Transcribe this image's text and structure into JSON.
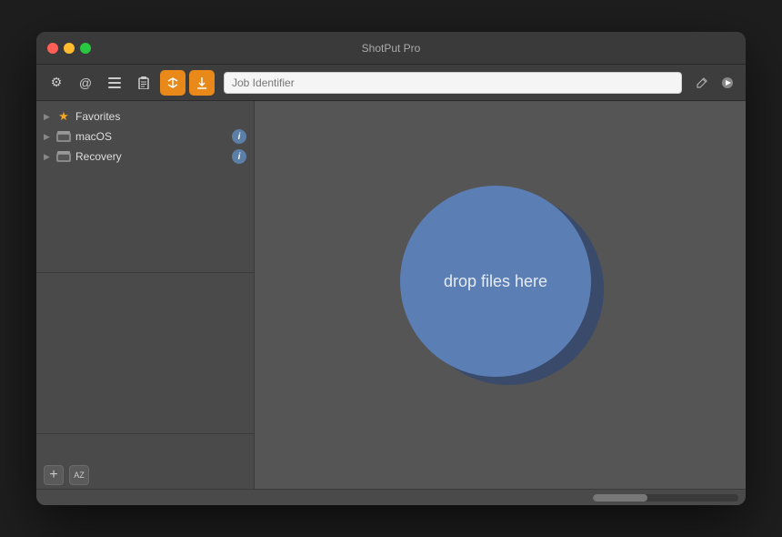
{
  "window": {
    "title": "ShotPut Pro",
    "traffic_lights": {
      "close": "close",
      "minimize": "minimize",
      "maximize": "maximize"
    }
  },
  "toolbar": {
    "buttons": [
      {
        "id": "settings",
        "icon": "⚙",
        "active": false,
        "label": "Settings"
      },
      {
        "id": "at",
        "icon": "@",
        "active": false,
        "label": "Email"
      },
      {
        "id": "list",
        "icon": "☰",
        "active": false,
        "label": "List"
      },
      {
        "id": "clipboard",
        "icon": "📋",
        "active": false,
        "label": "Clipboard"
      },
      {
        "id": "transfer",
        "icon": "⇄",
        "active": true,
        "label": "Transfer"
      },
      {
        "id": "download",
        "icon": "↓",
        "active": true,
        "label": "Download"
      }
    ],
    "job_identifier": {
      "placeholder": "Job Identifier",
      "value": ""
    },
    "right_buttons": [
      {
        "id": "pencil",
        "icon": "✏",
        "label": "Edit"
      },
      {
        "id": "play",
        "icon": "▶",
        "label": "Start"
      }
    ]
  },
  "sidebar": {
    "items": [
      {
        "id": "favorites",
        "label": "Favorites",
        "icon": "star",
        "has_arrow": true,
        "has_info": false
      },
      {
        "id": "macos",
        "label": "macOS",
        "icon": "drive",
        "has_arrow": true,
        "has_info": true
      },
      {
        "id": "recovery",
        "label": "Recovery",
        "icon": "drive",
        "has_arrow": true,
        "has_info": true
      }
    ],
    "bottom": {
      "add_label": "+",
      "sort_label": "AZ"
    }
  },
  "drop_zone": {
    "text": "drop files here"
  },
  "colors": {
    "accent_orange": "#e8891a",
    "circle_blue": "#5b7eb5",
    "circle_shadow": "#3a4a6a",
    "active_btn_bg": "#e8891a"
  }
}
